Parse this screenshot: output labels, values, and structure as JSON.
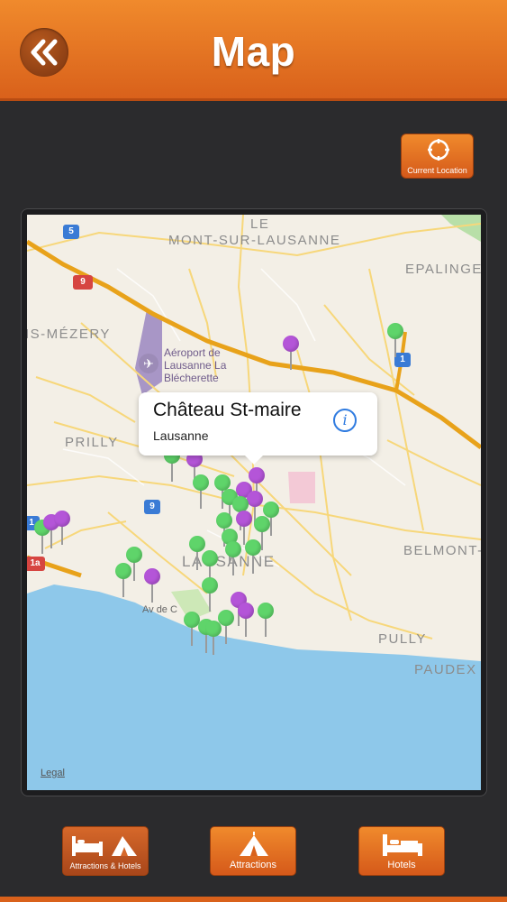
{
  "header": {
    "title": "Map",
    "back_icon": "double-chevron-left-icon"
  },
  "current_location": {
    "label": "Current Location",
    "icon": "crosshair-icon"
  },
  "map": {
    "places": {
      "le": "LE",
      "mont_sur_lausanne": "MONT-SUR-LAUSANNE",
      "epalinges": "EPALINGE",
      "mezery": "IS-MÉZERY",
      "prilly": "PRILLY",
      "lausanne": "LAUSANNE",
      "belmont": "BELMONT-S",
      "pully": "PULLY",
      "paudex": "PAUDEX",
      "av_de": "Av de C"
    },
    "airport": {
      "line1": "Aéroport de",
      "line2": "Lausanne La",
      "line3": "Blécherette"
    },
    "shields": {
      "s5": "5",
      "s9a": "9",
      "s9b": "9",
      "s1a": "1",
      "s1b": "1",
      "s1c": "1a"
    },
    "callout": {
      "title": "Château St-maire",
      "subtitle": "Lausanne",
      "info_icon": "info-icon"
    },
    "legal": "Legal",
    "pin_colors": {
      "attraction": "#5fd46a",
      "hotel": "#b455d8"
    }
  },
  "bottom_bar": {
    "attractions_hotels": "Attractions & Hotels",
    "attractions": "Attractions",
    "hotels": "Hotels"
  },
  "colors": {
    "accent": "#e8731f",
    "background": "#2b2b2d"
  }
}
